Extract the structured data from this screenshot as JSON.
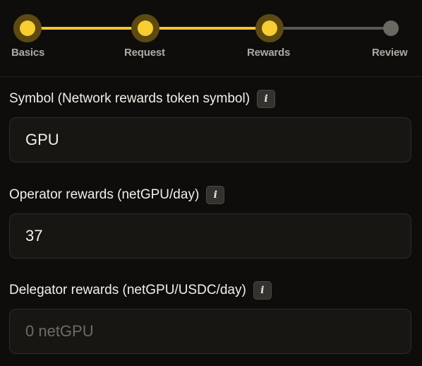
{
  "stepper": {
    "steps": [
      {
        "label": "Basics",
        "state": "completed"
      },
      {
        "label": "Request",
        "state": "completed"
      },
      {
        "label": "Rewards",
        "state": "current"
      },
      {
        "label": "Review",
        "state": "upcoming"
      }
    ]
  },
  "form": {
    "symbol": {
      "label": "Symbol (Network rewards token symbol)",
      "info_icon": "i",
      "value": "GPU"
    },
    "operator_rewards": {
      "label": "Operator rewards (netGPU/day)",
      "info_icon": "i",
      "value": "37"
    },
    "delegator_rewards": {
      "label": "Delegator rewards (netGPU/USDC/day)",
      "info_icon": "i",
      "value": "",
      "placeholder": "0 netGPU"
    }
  },
  "colors": {
    "accent": "#f7cd32",
    "background": "#0e0d0b",
    "input_background": "#181612"
  }
}
